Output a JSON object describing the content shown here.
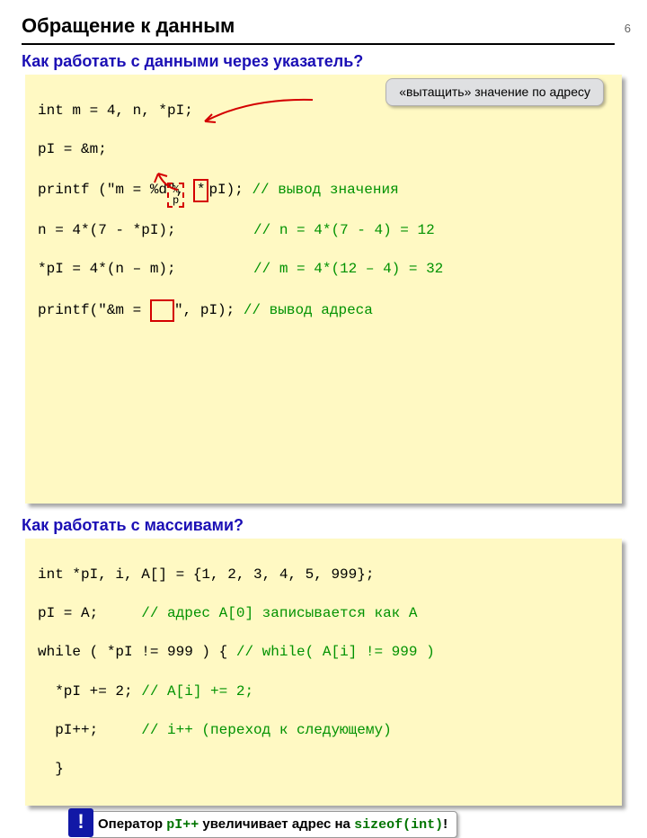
{
  "page_number": "6",
  "title": "Обращение к данным",
  "subtitle1": "Как работать с данными через указатель?",
  "subtitle2": "Как работать с массивами?",
  "callout_deref": "«вытащить» значение по адресу",
  "code1": {
    "l1a": "int m = 4, n, *pI;",
    "l2a": "pI = &m;",
    "l3a": "printf (\"m = %d\", ",
    "l3b": "*",
    "l3c": "pI); ",
    "l3d": "// вывод значения",
    "l4a": "n = 4*(7 - *pI);         ",
    "l4b": "// n = 4*(7 - 4) = 12",
    "l5a": "*pI = 4*(n – m);         ",
    "l5b": "// m = 4*(12 – 4) = 32",
    "l6a": "printf(\"&m = ",
    "l6b": "  ",
    "l6c": "\", pI); ",
    "l6d": "// вывод адреса",
    "dash_text": "%\np"
  },
  "code2": {
    "l1": "int *pI, i, A[] = {1, 2, 3, 4, 5, 999};",
    "l2a": "pI = A;     ",
    "l2b": "// адрес A[0] записывается как A",
    "l3a": "while ( *pI != 999 ) { ",
    "l3b": "// while( A[i] != 999 )",
    "l4a": "  *pI += 2; ",
    "l4b": "// A[i] += 2;",
    "l5a": "  pI++;     ",
    "l5b": "// i++ (переход к следующему)",
    "l6": "  }"
  },
  "note": {
    "t1": "Оператор ",
    "code1": "pI++",
    "t2": " увеличивает адрес на ",
    "code2": "sizeof(int)",
    "t3": "!",
    "badge": "!"
  }
}
